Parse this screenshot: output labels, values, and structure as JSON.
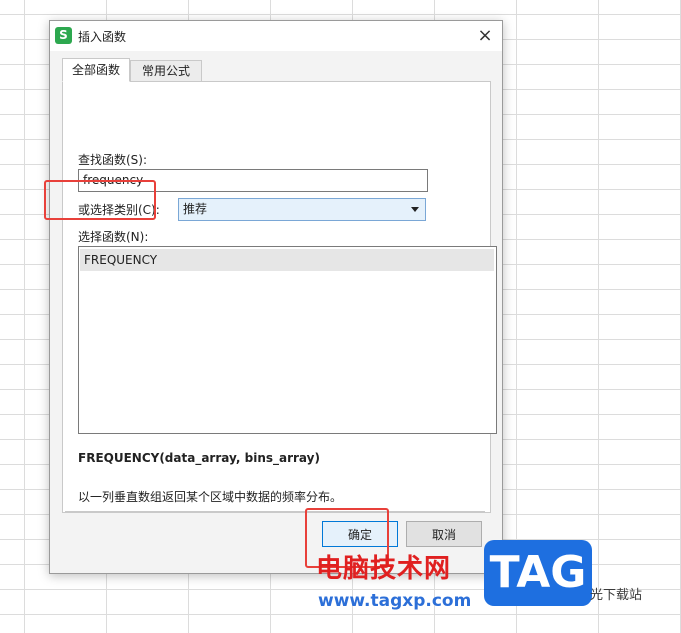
{
  "dialog": {
    "icon_letter": "S",
    "title": "插入函数",
    "close_glyph": "×",
    "tabs": [
      "全部函数",
      "常用公式"
    ],
    "search_label": "查找函数(S):",
    "search_value": "frequency",
    "category_label": "或选择类别(C):",
    "category_value": "推荐",
    "list_label": "选择函数(N):",
    "functions": [
      "FREQUENCY"
    ],
    "signature": "FREQUENCY(data_array, bins_array)",
    "description": "以一列垂直数组返回某个区域中数据的频率分布。",
    "ok_label": "确定",
    "cancel_label": "取消"
  },
  "watermark": {
    "site_name": "电脑技术网",
    "url": "www.tagxp.com",
    "badge": "TAG",
    "tail": "光下载站"
  },
  "colors": {
    "highlight": "#e8403a",
    "app_icon": "#2da84f",
    "badge": "#1e6fe0"
  }
}
